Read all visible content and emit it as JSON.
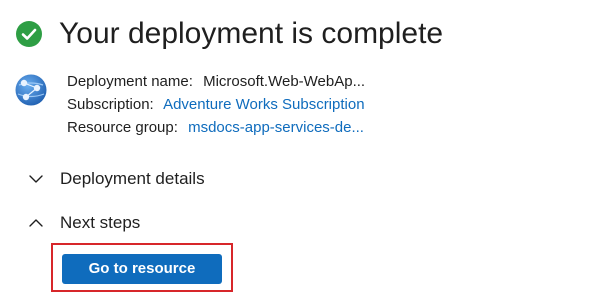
{
  "header": {
    "title": "Your deployment is complete",
    "status_icon": "success-check-icon",
    "status_color": "#2e9e44"
  },
  "deployment": {
    "icon": "web-app-deployment-icon",
    "name_label": "Deployment name:",
    "name_value": "Microsoft.Web-WebAp...",
    "subscription_label": "Subscription:",
    "subscription_value": "Adventure Works Subscription",
    "resource_group_label": "Resource group:",
    "resource_group_value": "msdocs-app-services-de..."
  },
  "sections": {
    "details_label": "Deployment details",
    "details_state": "collapsed",
    "next_steps_label": "Next steps",
    "next_steps_state": "expanded"
  },
  "actions": {
    "go_to_resource_label": "Go to resource",
    "accent_color": "#0f6cbd",
    "highlight_color": "#d7262a"
  }
}
